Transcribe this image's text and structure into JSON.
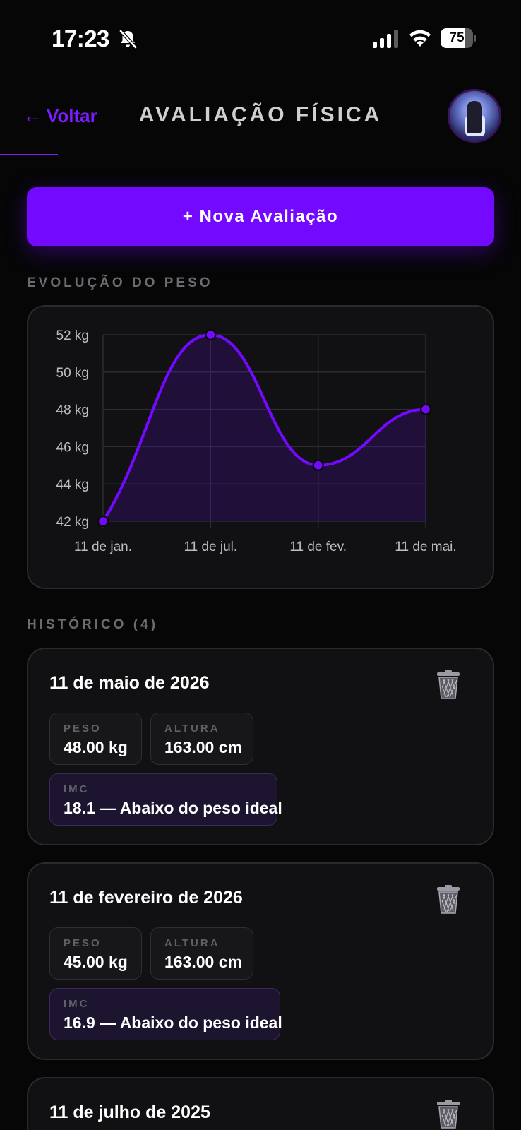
{
  "status_bar": {
    "time": "17:23",
    "battery": "75",
    "battery_level": 0.75,
    "icons": [
      "bell-slash-icon",
      "signal-icon",
      "wifi-icon",
      "battery-icon"
    ]
  },
  "header": {
    "back_label": "Voltar",
    "back_arrow": "←",
    "title": "AVALIAÇÃO FÍSICA",
    "avatar_icon": "user-avatar"
  },
  "actions": {
    "new_evaluation": "+ Nova Avaliação"
  },
  "colors": {
    "accent": "#7309ff",
    "background": "#060607",
    "card": "#111113",
    "imc_bg": "#1d1530"
  },
  "weight_section": {
    "label": "EVOLUÇÃO DO PESO"
  },
  "chart_data": {
    "type": "area",
    "title": "",
    "xlabel": "",
    "ylabel": "",
    "categories": [
      "11 de jan.",
      "11 de jul.",
      "11 de fev.",
      "11 de mai."
    ],
    "series": [
      {
        "values": [
          42,
          52,
          45,
          48
        ]
      }
    ],
    "ylim": [
      42,
      52
    ],
    "yticks": [
      "42 kg",
      "44 kg",
      "46 kg",
      "48 kg",
      "50 kg",
      "52 kg"
    ],
    "ytick_values": [
      42,
      44,
      46,
      48,
      50,
      52
    ],
    "grid": true,
    "curve": "smooth",
    "color": "#7309ff"
  },
  "history": {
    "label": "HISTÓRICO (4)",
    "peso_label": "PESO",
    "altura_label": "ALTURA",
    "imc_label": "IMC",
    "items": [
      {
        "date": "11 de maio de 2026",
        "peso": "48.00 kg",
        "altura": "163.00 cm",
        "imc": "18.1 — Abaixo do peso ideal"
      },
      {
        "date": "11 de fevereiro de 2026",
        "peso": "45.00 kg",
        "altura": "163.00 cm",
        "imc": "16.9 — Abaixo do peso ideal"
      },
      {
        "date": "11 de julho de 2025"
      }
    ]
  }
}
